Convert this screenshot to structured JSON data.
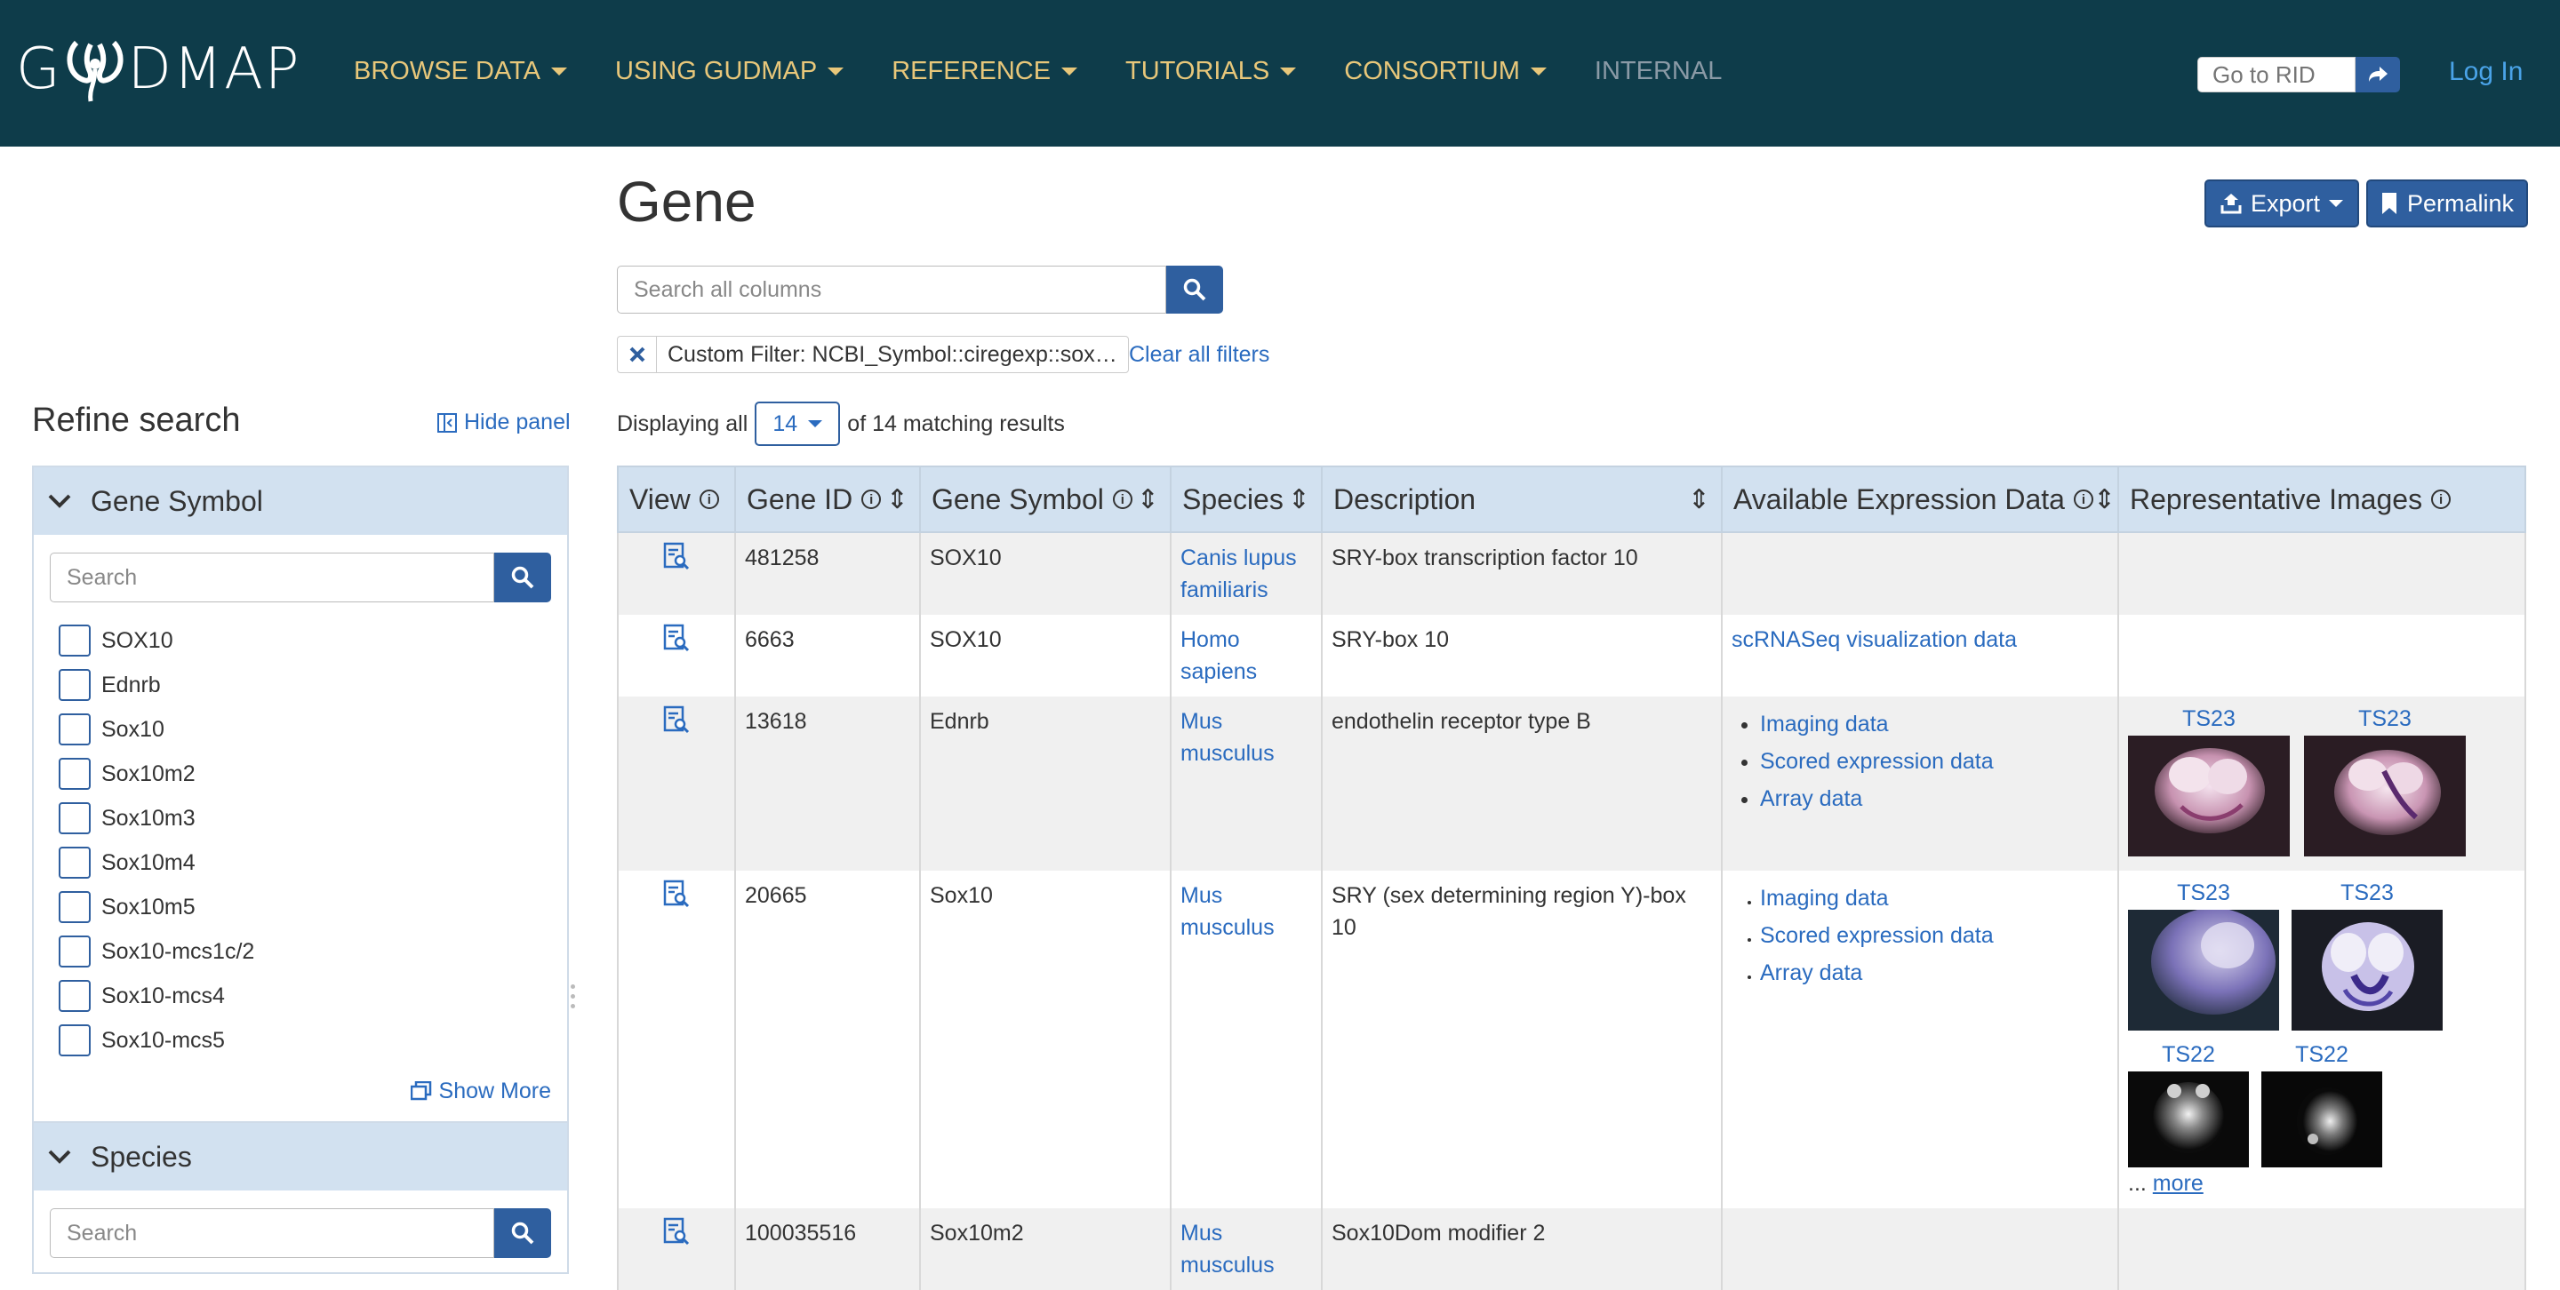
{
  "nav": {
    "logo_text": "GUDMAP",
    "menu": [
      {
        "label": "BROWSE DATA",
        "caret": true
      },
      {
        "label": "USING GUDMAP",
        "caret": true
      },
      {
        "label": "REFERENCE",
        "caret": true
      },
      {
        "label": "TUTORIALS",
        "caret": true
      },
      {
        "label": "CONSORTIUM",
        "caret": true
      },
      {
        "label": "INTERNAL",
        "caret": false
      }
    ],
    "rid_placeholder": "Go to RID",
    "login": "Log In"
  },
  "sidebar": {
    "title": "Refine search",
    "hide_panel": "Hide panel",
    "facets": [
      {
        "title": "Gene Symbol",
        "search_placeholder": "Search",
        "items": [
          "SOX10",
          "Ednrb",
          "Sox10",
          "Sox10m2",
          "Sox10m3",
          "Sox10m4",
          "Sox10m5",
          "Sox10-mcs1c/2",
          "Sox10-mcs4",
          "Sox10-mcs5"
        ],
        "show_more": "Show More"
      },
      {
        "title": "Species",
        "search_placeholder": "Search"
      }
    ]
  },
  "main": {
    "title": "Gene",
    "export_label": "Export",
    "permalink_label": "Permalink",
    "search_placeholder": "Search all columns",
    "filter_chip": "Custom Filter: NCBI_Symbol::ciregexp::sox…",
    "clear_filters": "Clear all filters",
    "displaying_prefix": "Displaying all",
    "page_size": "14",
    "displaying_suffix": "of 14 matching results",
    "columns": [
      "View",
      "Gene ID",
      "Gene Symbol",
      "Species",
      "Description",
      "Available Expression Data",
      "Representative Images"
    ],
    "rows": [
      {
        "gene_id": "481258",
        "symbol": "SOX10",
        "species": "Canis lupus familiaris",
        "description": "SRY-box transcription factor 10",
        "expression": [],
        "expression_single": "",
        "images": [],
        "more": ""
      },
      {
        "gene_id": "6663",
        "symbol": "SOX10",
        "species": "Homo sapiens",
        "description": "SRY-box 10",
        "expression": [],
        "expression_single": "scRNASeq visualization data",
        "images": [],
        "more": ""
      },
      {
        "gene_id": "13618",
        "symbol": "Ednrb",
        "species": "Mus musculus",
        "description": "endothelin receptor type B",
        "expression": [
          "Imaging data",
          "Scored expression data",
          "Array data"
        ],
        "expression_single": "",
        "images": [
          {
            "label": "TS23"
          },
          {
            "label": "TS23"
          }
        ],
        "more": ""
      },
      {
        "gene_id": "20665",
        "symbol": "Sox10",
        "species": "Mus musculus",
        "description": "SRY (sex determining region Y)-box 10",
        "expression": [
          "Imaging data",
          "Scored expression data",
          "Array data"
        ],
        "expression_single": "",
        "images": [
          {
            "label": "TS23"
          },
          {
            "label": "TS23"
          },
          {
            "label": "TS22"
          },
          {
            "label": "TS22"
          }
        ],
        "more_prefix": "...",
        "more": "more"
      },
      {
        "gene_id": "100035516",
        "symbol": "Sox10m2",
        "species": "Mus musculus",
        "description": "Sox10Dom modifier 2",
        "expression": [],
        "expression_single": "",
        "images": [],
        "more": ""
      }
    ]
  },
  "colors": {
    "nav_bg": "#0e3c4a",
    "nav_link": "#e8c77a",
    "primary": "#2f5f9f",
    "link": "#2a6bbf",
    "table_header": "#d2e1f0"
  }
}
